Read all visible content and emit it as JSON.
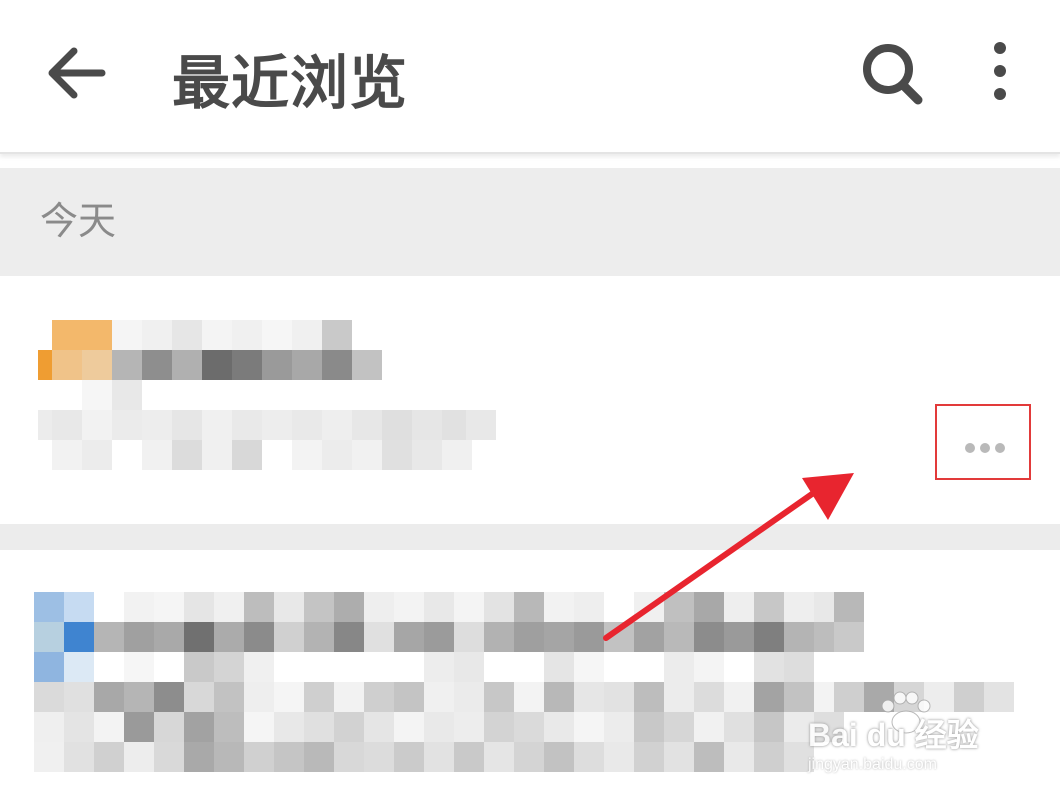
{
  "header": {
    "title": "最近浏览",
    "back_icon": "back-arrow-icon",
    "search_icon": "search-icon",
    "more_icon": "more-vertical-icon"
  },
  "section": {
    "label": "今天"
  },
  "items": [
    {
      "more_icon": "more-horizontal-icon",
      "content": "pixelated (obscured)"
    },
    {
      "content": "pixelated (obscured)"
    }
  ],
  "annotation": {
    "highlight_color": "#e23a3a",
    "arrow_color": "#e8252f"
  },
  "watermark": {
    "main": "Bai du 经验",
    "sub": "jingyan.baidu.com"
  },
  "colors": {
    "title": "#4a4a4a",
    "section_bg": "#ededed",
    "section_text": "#8a8a8a"
  }
}
